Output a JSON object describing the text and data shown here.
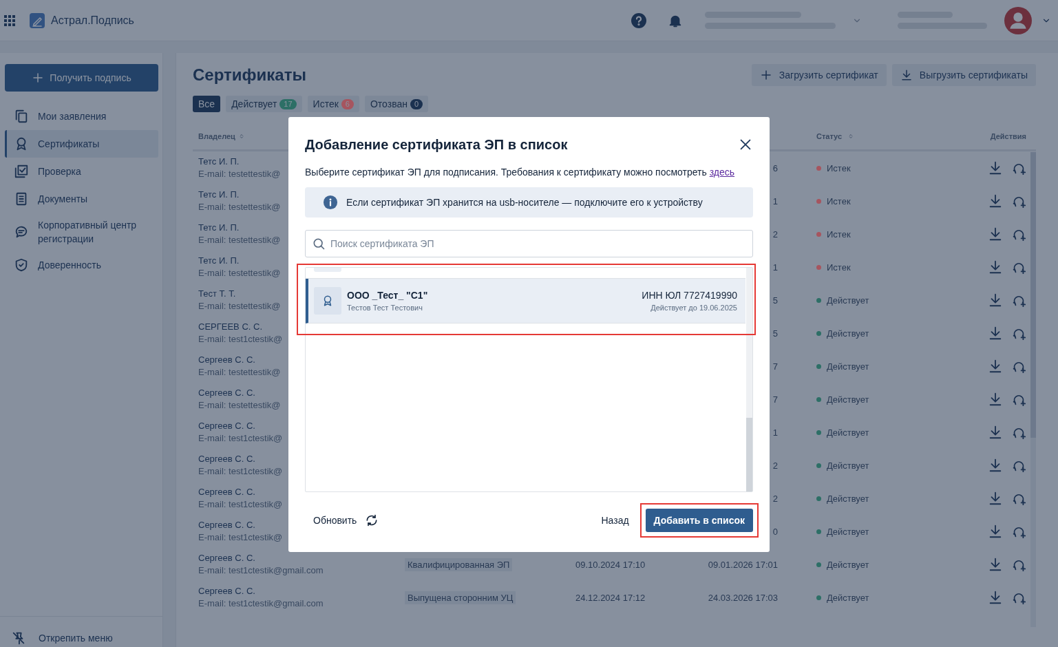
{
  "app": {
    "title": "Астрал.Подпись"
  },
  "sidebar": {
    "primary_button": "Получить подпись",
    "footer_button": "Открепить меню",
    "items": [
      {
        "label": "Мои заявления",
        "kind": "copy",
        "selected": false
      },
      {
        "label": "Сертификаты",
        "kind": "award",
        "selected": true
      },
      {
        "label": "Проверка",
        "kind": "check",
        "selected": false
      },
      {
        "label": "Документы",
        "kind": "doc",
        "selected": false
      },
      {
        "label": "Корпоративный центр регистрации",
        "kind": "chat",
        "selected": false
      },
      {
        "label": "Доверенность",
        "kind": "shield",
        "selected": false
      }
    ]
  },
  "page": {
    "title": "Сертификаты",
    "actions": [
      {
        "label": "Загрузить сертификат",
        "kind": "add"
      },
      {
        "label": "Выгрузить сертификаты",
        "kind": "download"
      }
    ],
    "filters": [
      {
        "label": "Все",
        "selected": true
      },
      {
        "label": "Действует",
        "count": "17",
        "color": "#2d6f66",
        "selected": false
      },
      {
        "label": "Истек",
        "count": "6",
        "color": "#a6555f",
        "selected": false
      },
      {
        "label": "Отозван",
        "count": "0",
        "color": "#1b3150",
        "selected": false
      }
    ]
  },
  "table": {
    "columns": [
      {
        "label": "Владелец",
        "sortable": true
      },
      {
        "label": "Статус",
        "sortable": true
      },
      {
        "label": "Действия",
        "sortable": false
      }
    ],
    "rows": [
      {
        "owner": "Тетс И. П.",
        "email": "E-mail: testettestik@",
        "expiry": "6",
        "status": "Истек",
        "color": "#a6555f"
      },
      {
        "owner": "Тетс И. П.",
        "email": "E-mail: testettestik@",
        "expiry": "1",
        "status": "Истек",
        "color": "#a6555f"
      },
      {
        "owner": "Тетс И. П.",
        "email": "E-mail: testettestik@",
        "expiry": "2",
        "status": "Истек",
        "color": "#a6555f"
      },
      {
        "owner": "Тетс И. П.",
        "email": "E-mail: testettestik@",
        "expiry": "1",
        "status": "Истек",
        "color": "#a6555f"
      },
      {
        "owner": "Тест Т. Т.",
        "email": "E-mail: testettestik@",
        "expiry": "5",
        "status": "Действует",
        "color": "#2d6f66"
      },
      {
        "owner": "СЕРГЕЕВ С. С.",
        "email": "E-mail: test1ctestik@",
        "expiry": "5",
        "status": "Действует",
        "color": "#2d6f66"
      },
      {
        "owner": "Сергеев С. С.",
        "email": "E-mail: testettestik@",
        "expiry": "7",
        "status": "Действует",
        "color": "#2d6f66"
      },
      {
        "owner": "Сергеев С. С.",
        "email": "E-mail: testettestik@",
        "expiry": "7",
        "status": "Действует",
        "color": "#2d6f66"
      },
      {
        "owner": "Сергеев С. С.",
        "email": "E-mail: test1ctestik@",
        "expiry": "1",
        "status": "Действует",
        "color": "#2d6f66"
      },
      {
        "owner": "Сергеев С. С.",
        "email": "E-mail: test1ctestik@",
        "expiry": "2",
        "status": "Действует",
        "color": "#2d6f66"
      },
      {
        "owner": "Сергеев С. С.",
        "email": "E-mail: test1ctestik@",
        "expiry": "2",
        "status": "Действует",
        "color": "#2d6f66"
      },
      {
        "owner": "Сергеев С. С.",
        "email": "E-mail: test1ctestik@",
        "expiry": "0",
        "status": "Действует",
        "color": "#2d6f66"
      },
      {
        "owner": "Сергеев С. С.",
        "email": "E-mail: test1ctestik@gmail.com",
        "type": "Квалифицированная ЭП",
        "issued": "09.10.2024 17:10",
        "expiry": "09.01.2026 17:01",
        "status": "Действует",
        "color": "#2d6f66"
      },
      {
        "owner": "Сергеев С. С.",
        "email": "E-mail: test1ctestik@gmail.com",
        "type": "Выпущена сторонним УЦ",
        "issued": "24.12.2024 17:12",
        "expiry": "24.03.2026 17:03",
        "status": "Действует",
        "color": "#2d6f66"
      }
    ]
  },
  "modal": {
    "title": "Добавление сертификата ЭП в список",
    "description": "Выберите сертификат ЭП для подписания. Требования к сертификату можно посмотреть",
    "link": "здесь",
    "info": "Если сертификат ЭП хранится на usb-носителе — подключите его к устройству",
    "search": {
      "placeholder": "Поиск сертификата ЭП"
    },
    "certificates": [
      {
        "name": "ООО _Тест_ \"С1\"",
        "holder": "Тестов Тест Тестович",
        "inn": "ИНН ЮЛ 7727419990",
        "valid": "Действует до 19.06.2025",
        "selected": true
      }
    ],
    "refresh": "Обновить",
    "back": "Назад",
    "submit": "Добавить в список"
  }
}
